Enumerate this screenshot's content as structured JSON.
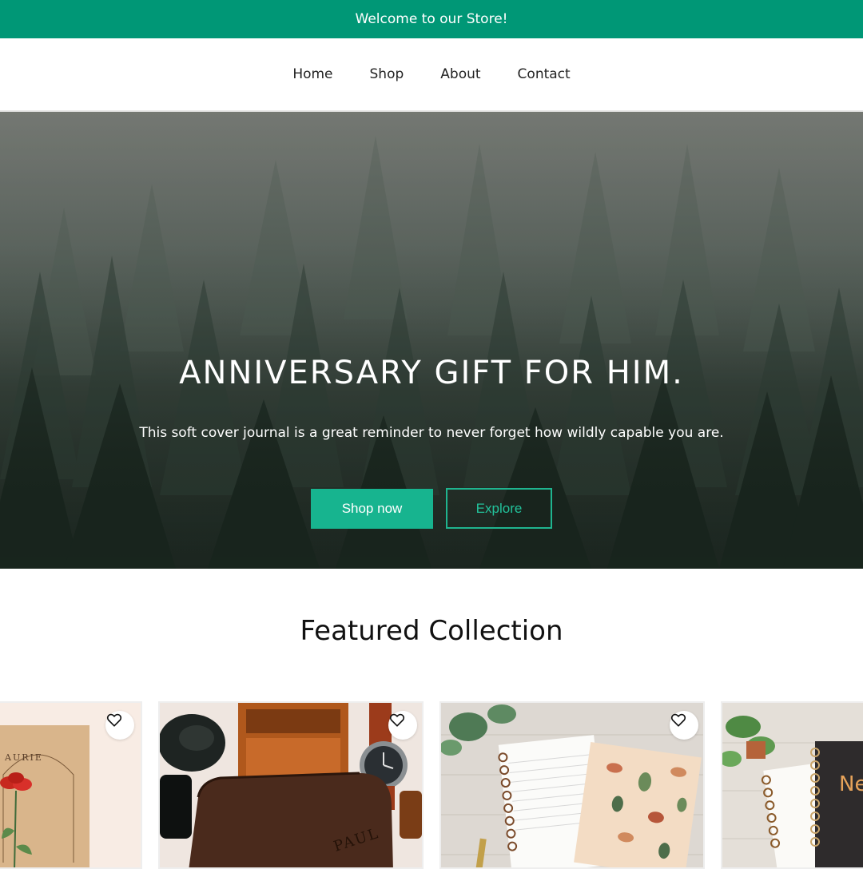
{
  "announcement": {
    "text": "Welcome to our Store!"
  },
  "nav": {
    "items": [
      "Home",
      "Shop",
      "About",
      "Contact"
    ]
  },
  "hero": {
    "title": "ANNIVERSARY GIFT FOR HIM.",
    "subtitle": "This soft cover journal is a great reminder to never forget how wildly capable you are.",
    "primary_button": "Shop now",
    "secondary_button": "Explore"
  },
  "featured": {
    "title": "Featured Collection",
    "products": [
      {
        "image": "botanical-card-image",
        "icon": "heart-icon",
        "image_text": "AURIE"
      },
      {
        "image": "leather-wallet-image",
        "icon": "heart-icon",
        "image_text": "PAUL"
      },
      {
        "image": "floral-notebooks-image",
        "icon": "heart-icon"
      },
      {
        "image": "spiral-notebooks-image",
        "icon": "heart-icon",
        "image_text": "Nev for how ca"
      }
    ]
  },
  "colors": {
    "brand": "#009776",
    "button": "#17b48f",
    "outline": "#1fb48f"
  }
}
